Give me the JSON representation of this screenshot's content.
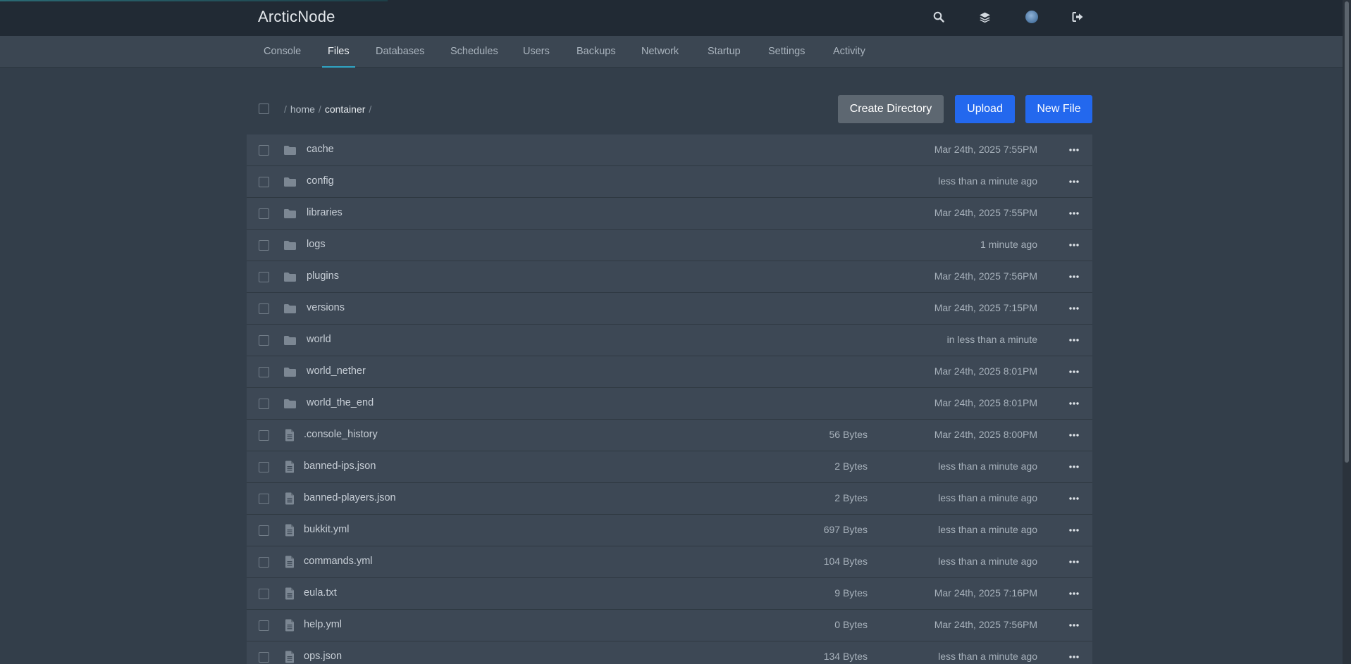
{
  "app": {
    "brand": "ArcticNode"
  },
  "topbar": {
    "icons": [
      "search-icon",
      "layers-icon",
      "avatar",
      "logout-icon"
    ]
  },
  "tabs": [
    {
      "label": "Console",
      "active": false
    },
    {
      "label": "Files",
      "active": true
    },
    {
      "label": "Databases",
      "active": false
    },
    {
      "label": "Schedules",
      "active": false
    },
    {
      "label": "Users",
      "active": false
    },
    {
      "label": "Backups",
      "active": false
    },
    {
      "label": "Network",
      "active": false
    },
    {
      "label": "Startup",
      "active": false
    },
    {
      "label": "Settings",
      "active": false
    },
    {
      "label": "Activity",
      "active": false
    }
  ],
  "breadcrumb": {
    "separator": "/",
    "parts": [
      "home",
      "container"
    ]
  },
  "actions": {
    "create_directory": "Create Directory",
    "upload": "Upload",
    "new_file": "New File"
  },
  "colors": {
    "accent_blue": "#2368ee",
    "tab_active": "#2fa5c5",
    "background": "#333e4a"
  },
  "files": [
    {
      "type": "dir",
      "name": "cache",
      "size": "",
      "modified": "Mar 24th, 2025 7:55PM"
    },
    {
      "type": "dir",
      "name": "config",
      "size": "",
      "modified": "less than a minute ago"
    },
    {
      "type": "dir",
      "name": "libraries",
      "size": "",
      "modified": "Mar 24th, 2025 7:55PM"
    },
    {
      "type": "dir",
      "name": "logs",
      "size": "",
      "modified": "1 minute ago"
    },
    {
      "type": "dir",
      "name": "plugins",
      "size": "",
      "modified": "Mar 24th, 2025 7:56PM"
    },
    {
      "type": "dir",
      "name": "versions",
      "size": "",
      "modified": "Mar 24th, 2025 7:15PM"
    },
    {
      "type": "dir",
      "name": "world",
      "size": "",
      "modified": "in less than a minute"
    },
    {
      "type": "dir",
      "name": "world_nether",
      "size": "",
      "modified": "Mar 24th, 2025 8:01PM"
    },
    {
      "type": "dir",
      "name": "world_the_end",
      "size": "",
      "modified": "Mar 24th, 2025 8:01PM"
    },
    {
      "type": "file",
      "name": ".console_history",
      "size": "56 Bytes",
      "modified": "Mar 24th, 2025 8:00PM"
    },
    {
      "type": "file",
      "name": "banned-ips.json",
      "size": "2 Bytes",
      "modified": "less than a minute ago"
    },
    {
      "type": "file",
      "name": "banned-players.json",
      "size": "2 Bytes",
      "modified": "less than a minute ago"
    },
    {
      "type": "file",
      "name": "bukkit.yml",
      "size": "697 Bytes",
      "modified": "less than a minute ago"
    },
    {
      "type": "file",
      "name": "commands.yml",
      "size": "104 Bytes",
      "modified": "less than a minute ago"
    },
    {
      "type": "file",
      "name": "eula.txt",
      "size": "9 Bytes",
      "modified": "Mar 24th, 2025 7:16PM"
    },
    {
      "type": "file",
      "name": "help.yml",
      "size": "0 Bytes",
      "modified": "Mar 24th, 2025 7:56PM"
    },
    {
      "type": "file",
      "name": "ops.json",
      "size": "134 Bytes",
      "modified": "less than a minute ago"
    }
  ]
}
